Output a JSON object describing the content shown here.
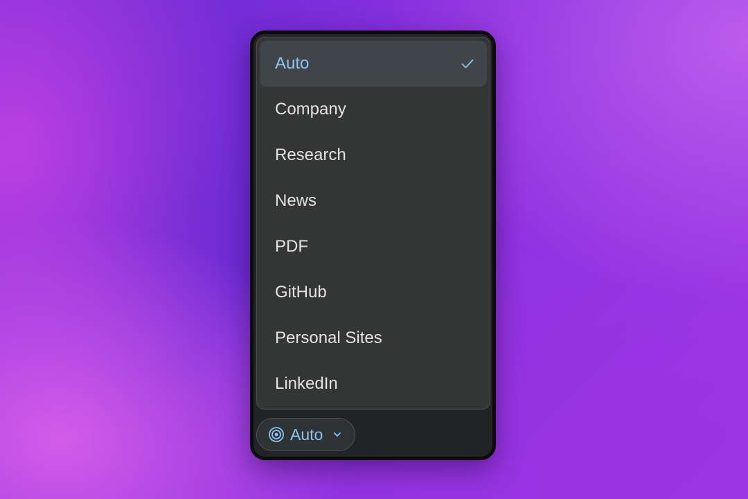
{
  "menu": {
    "items": [
      {
        "label": "Auto",
        "selected": true
      },
      {
        "label": "Company",
        "selected": false
      },
      {
        "label": "Research",
        "selected": false
      },
      {
        "label": "News",
        "selected": false
      },
      {
        "label": "PDF",
        "selected": false
      },
      {
        "label": "GitHub",
        "selected": false
      },
      {
        "label": "Personal Sites",
        "selected": false
      },
      {
        "label": "LinkedIn",
        "selected": false
      }
    ],
    "selected_icon": "check-icon"
  },
  "mode_button": {
    "label": "Auto",
    "icon": "target-icon",
    "dropdown_icon": "chevron-down-icon"
  },
  "colors": {
    "accent": "#8ec4f2",
    "panel_bg": "#222324",
    "menu_bg": "#343535",
    "selected_bg": "#3f4548",
    "text": "#e3e3e3"
  }
}
